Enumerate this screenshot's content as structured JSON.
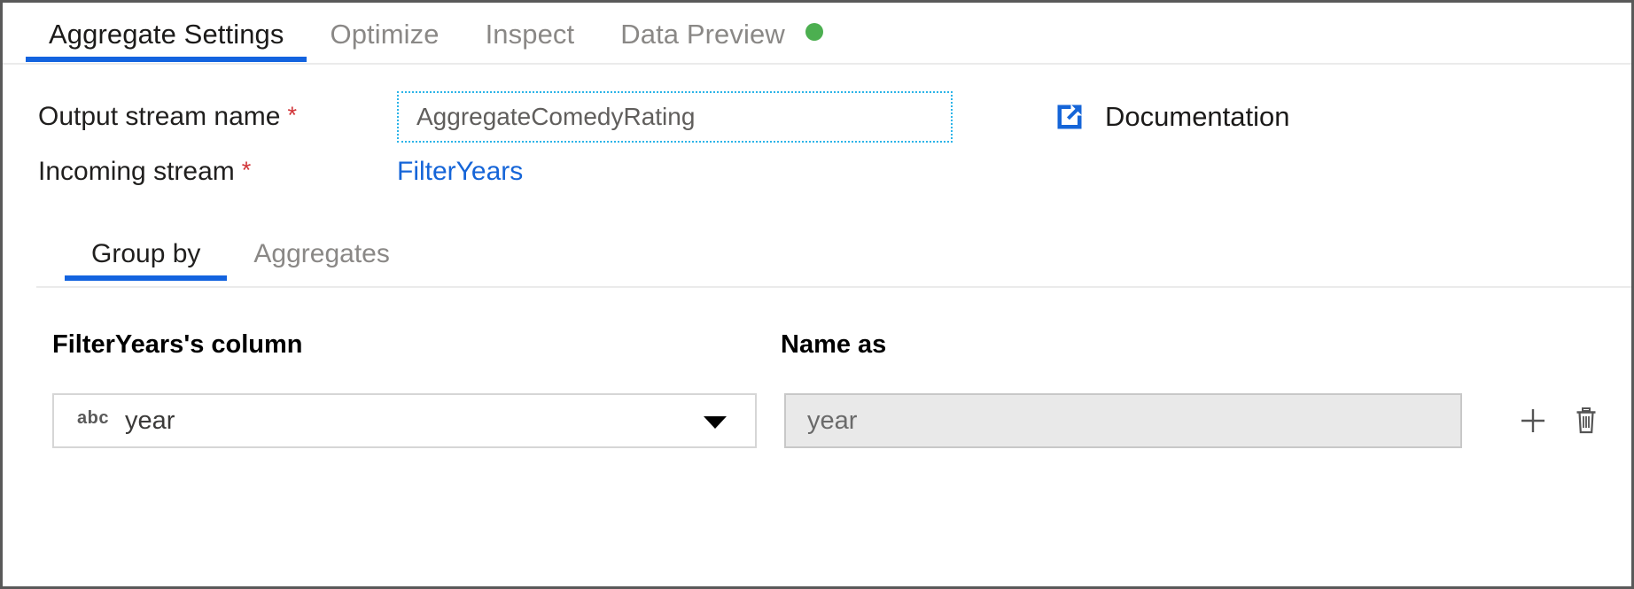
{
  "window": {
    "title": "Aggregate Settings"
  },
  "tabs": [
    {
      "label": "Aggregate Settings",
      "active": true,
      "indicator": null
    },
    {
      "label": "Optimize",
      "active": false,
      "indicator": null
    },
    {
      "label": "Inspect",
      "active": false,
      "indicator": null
    },
    {
      "label": "Data Preview",
      "active": false,
      "indicator": "status-dot-green"
    }
  ],
  "form": {
    "output_stream": {
      "label": "Output stream name",
      "required_marker": "*",
      "value": "AggregateComedyRating",
      "placeholder": "AggregateComedyRating"
    },
    "incoming_stream": {
      "label": "Incoming stream",
      "required_marker": "*",
      "value": "FilterYears"
    },
    "documentation": {
      "label": "Documentation",
      "icon": "external-link-icon"
    }
  },
  "subtabs": [
    {
      "label": "Group by",
      "active": true
    },
    {
      "label": "Aggregates",
      "active": false
    }
  ],
  "grid": {
    "headers": {
      "column": "FilterYears's column",
      "name_as": "Name as"
    },
    "rows": [
      {
        "type_badge": "abc",
        "column_value": "year",
        "name_as_value": "year",
        "name_as_placeholder": "year",
        "add_icon": "plus-icon",
        "delete_icon": "trash-icon"
      }
    ]
  },
  "colors": {
    "accent": "#1363df",
    "link": "#1565d8",
    "required": "#d13438",
    "status_green": "#4caf50",
    "focus_border": "#2cb4e8"
  }
}
